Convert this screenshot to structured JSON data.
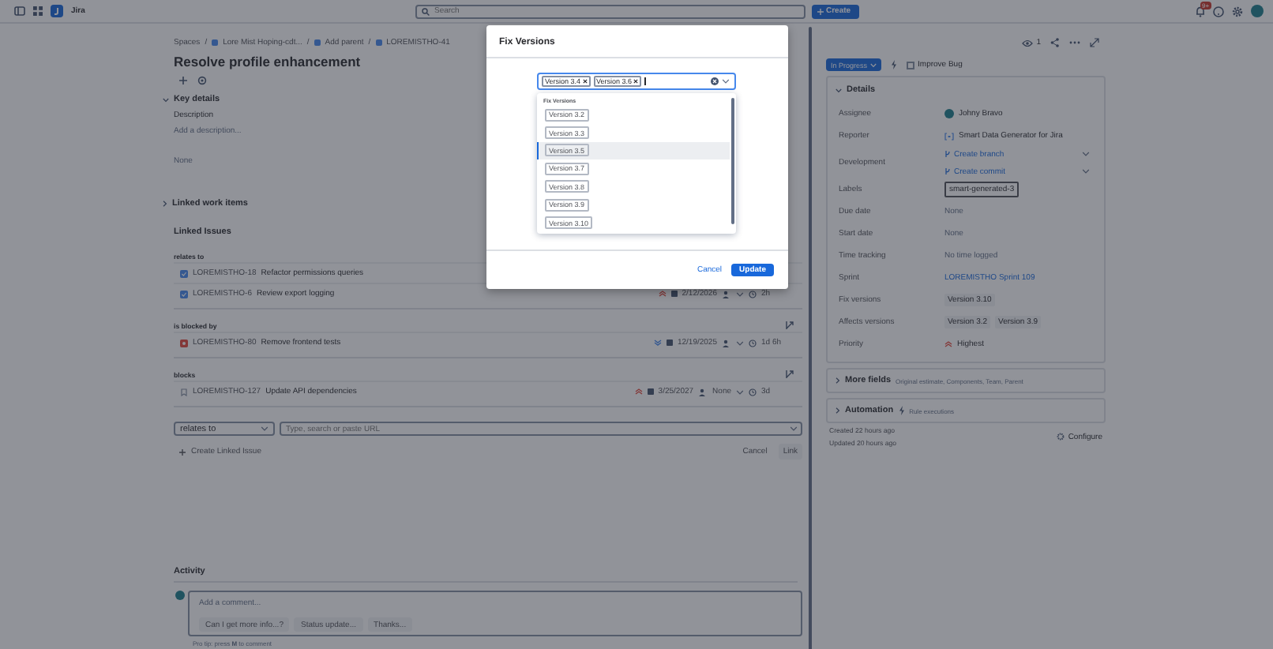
{
  "top_bar": {
    "app_name": "Jira",
    "search_placeholder": "Search",
    "create_label": "Create",
    "notification_badge": "9+"
  },
  "issue": {
    "breadcrumbs": [
      "Spaces",
      "Lore Mist Hoping-cdt...",
      "Add parent",
      "LOREMISTHO-41"
    ],
    "separator": "/",
    "title": "Resolve profile enhancement"
  },
  "key_details": {
    "heading": "Key details",
    "description_label": "Description",
    "description_placeholder": "Add a description...",
    "empty_value": "None"
  },
  "linked_work_items": "Linked work items",
  "linked_issues": {
    "heading": "Linked Issues",
    "groups": [
      {
        "relation": "relates to",
        "action_icon": false,
        "issues": [
          {
            "kind": "task",
            "key": "LOREMISTHO-18",
            "summary": "Refactor permissions queries"
          },
          {
            "kind": "task",
            "key": "LOREMISTHO-6",
            "summary": "Review export logging",
            "priority": {
              "kind": "highest"
            },
            "date": "2/12/2026",
            "estimate": "2h"
          }
        ]
      },
      {
        "relation": "is blocked by",
        "action_icon": true,
        "issues": [
          {
            "kind": "bug",
            "key": "LOREMISTHO-80",
            "summary": "Remove frontend tests",
            "priority": {
              "kind": "low"
            },
            "date": "12/19/2025",
            "estimate": "1d 6h"
          }
        ]
      },
      {
        "relation": "blocks",
        "action_icon": true,
        "issues": [
          {
            "kind": "story",
            "key": "LOREMISTHO-127",
            "summary": "Update API dependencies",
            "priority": {
              "kind": "highest"
            },
            "date": "3/25/2027",
            "assignee": "None",
            "estimate": "3d"
          }
        ]
      }
    ],
    "link_type": "relates to",
    "link_placeholder": "Type, search or paste URL",
    "create_label": "Create Linked Issue",
    "cancel_label": "Cancel",
    "link_label": "Link"
  },
  "activity": {
    "heading": "Activity",
    "comment_placeholder": "Add a comment...",
    "quick_replies": [
      "Can I get more info...?",
      "Status update...",
      "Thanks..."
    ],
    "pro_tip": "Pro tip: press **M** to comment"
  },
  "side_panel": {
    "watchers": "1",
    "status": "In Progress",
    "improve_label": "Improve Bug",
    "details_heading": "Details",
    "fields": [
      {
        "kind": "user",
        "label": "Assignee",
        "value": "Johny Bravo"
      },
      {
        "kind": "app",
        "label": "Reporter",
        "value": "Smart Data Generator for Jira"
      },
      {
        "kind": "dev",
        "label": "Development",
        "values": [
          "Create branch",
          "Create commit"
        ]
      },
      {
        "kind": "tags",
        "label": "Labels",
        "values": [
          "smart-generated-3"
        ]
      },
      {
        "kind": "muted",
        "label": "Due date",
        "value": "None"
      },
      {
        "kind": "muted",
        "label": "Start date",
        "value": "None"
      },
      {
        "kind": "muted",
        "label": "Time tracking",
        "value": "No time logged"
      },
      {
        "kind": "link",
        "label": "Sprint",
        "value": "LOREMISTHO Sprint 109"
      },
      {
        "kind": "tags",
        "label": "Fix versions",
        "values": [
          "Version 3.10"
        ]
      },
      {
        "kind": "tags",
        "label": "Affects versions",
        "values": [
          "Version 3.2",
          "Version 3.9"
        ]
      },
      {
        "kind": "priority",
        "label": "Priority",
        "value": "Highest"
      }
    ],
    "more_fields": "More fields",
    "more_fields_hint": "Original estimate, Components, Team, Parent",
    "automation": "Automation",
    "automation_hint": "Rule executions",
    "created": "Created 22 hours ago",
    "updated": "Updated 20 hours ago",
    "configure_label": "Configure"
  },
  "dialog": {
    "title": "Fix Versions",
    "selected": [
      "Version 3.4",
      "Version 3.6"
    ],
    "group_label": "Fix Versions",
    "options": [
      {
        "label": "Version 3.2",
        "focused": false
      },
      {
        "label": "Version 3.3",
        "focused": false
      },
      {
        "label": "Version 3.5",
        "focused": true
      },
      {
        "label": "Version 3.7",
        "focused": false
      },
      {
        "label": "Version 3.8",
        "focused": false
      },
      {
        "label": "Version 3.9",
        "focused": false
      },
      {
        "label": "Version 3.10",
        "focused": false
      }
    ],
    "cancel_label": "Cancel",
    "update_label": "Update"
  }
}
